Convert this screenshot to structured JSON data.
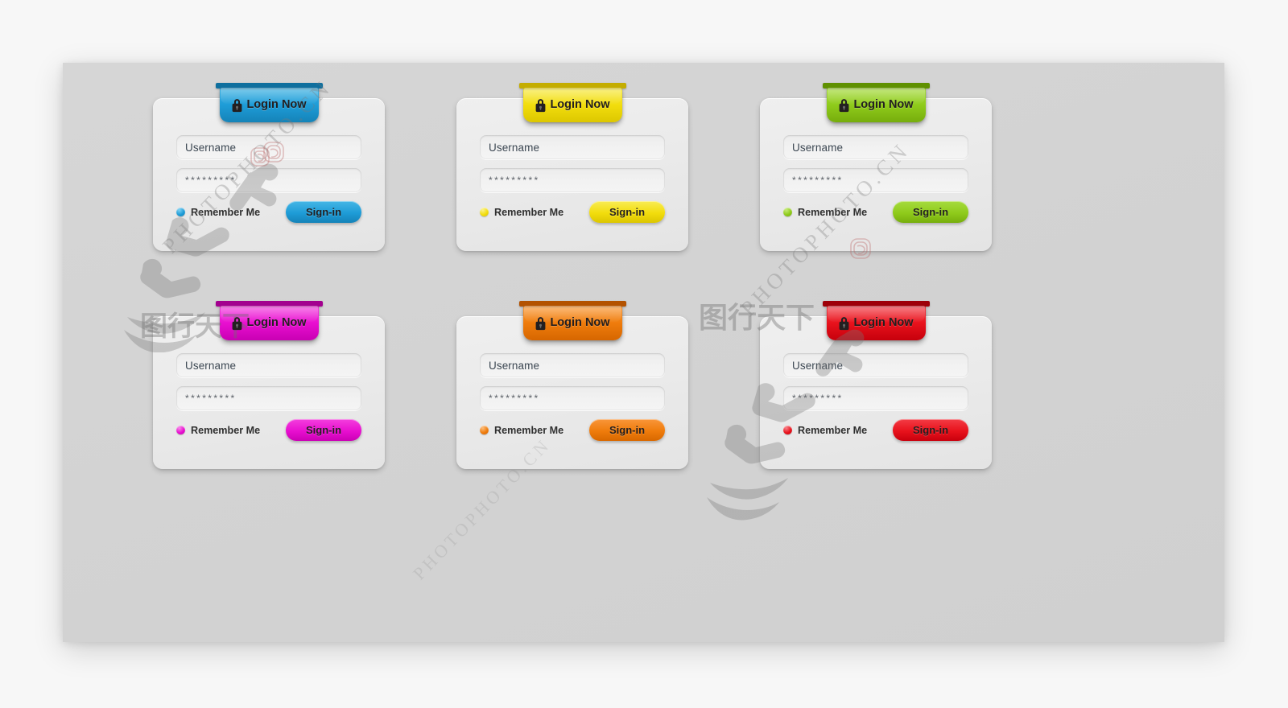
{
  "page": {
    "background_color": "#f7f7f7",
    "panel_color": "#d3d3d3"
  },
  "common": {
    "tab_label": "Login Now",
    "lock_icon": "lock-icon",
    "username_value": "Username",
    "username_placeholder": "Username",
    "password_value": "*********",
    "password_placeholder": "*********",
    "remember_label": "Remember Me",
    "signin_label": "Sign-in"
  },
  "cards": [
    {
      "name": "blue",
      "accent": "#1e9cd7",
      "accent_dark": "#1583b8",
      "accent_shade": "#0f6f9e",
      "tab_label": "Login Now",
      "username": "Username",
      "password": "*********",
      "remember": "Remember Me",
      "signin": "Sign-in"
    },
    {
      "name": "yellow",
      "accent": "#f2dd0d",
      "accent_dark": "#dcc400",
      "accent_shade": "#c4ad00",
      "tab_label": "Login Now",
      "username": "Username",
      "password": "*********",
      "remember": "Remember Me",
      "signin": "Sign-in"
    },
    {
      "name": "green",
      "accent": "#8fcb1b",
      "accent_dark": "#76ad0c",
      "accent_shade": "#5f9000",
      "tab_label": "Login Now",
      "username": "Username",
      "password": "*********",
      "remember": "Remember Me",
      "signin": "Sign-in"
    },
    {
      "name": "magenta",
      "accent": "#e80fd0",
      "accent_dark": "#c900b3",
      "accent_shade": "#a3008f",
      "tab_label": "Login Now",
      "username": "Username",
      "password": "*********",
      "remember": "Remember Me",
      "signin": "Sign-in"
    },
    {
      "name": "orange",
      "accent": "#ef7c0c",
      "accent_dark": "#d66600",
      "accent_shade": "#b35200",
      "tab_label": "Login Now",
      "username": "Username",
      "password": "*********",
      "remember": "Remember Me",
      "signin": "Sign-in"
    },
    {
      "name": "red",
      "accent": "#e8121c",
      "accent_dark": "#c6000c",
      "accent_shade": "#9e0008",
      "tab_label": "Login Now",
      "username": "Username",
      "password": "*********",
      "remember": "Remember Me",
      "signin": "Sign-in"
    }
  ],
  "watermark": {
    "text": "PHOTOPHOTO.CN",
    "cn_logo": "图行天下"
  }
}
